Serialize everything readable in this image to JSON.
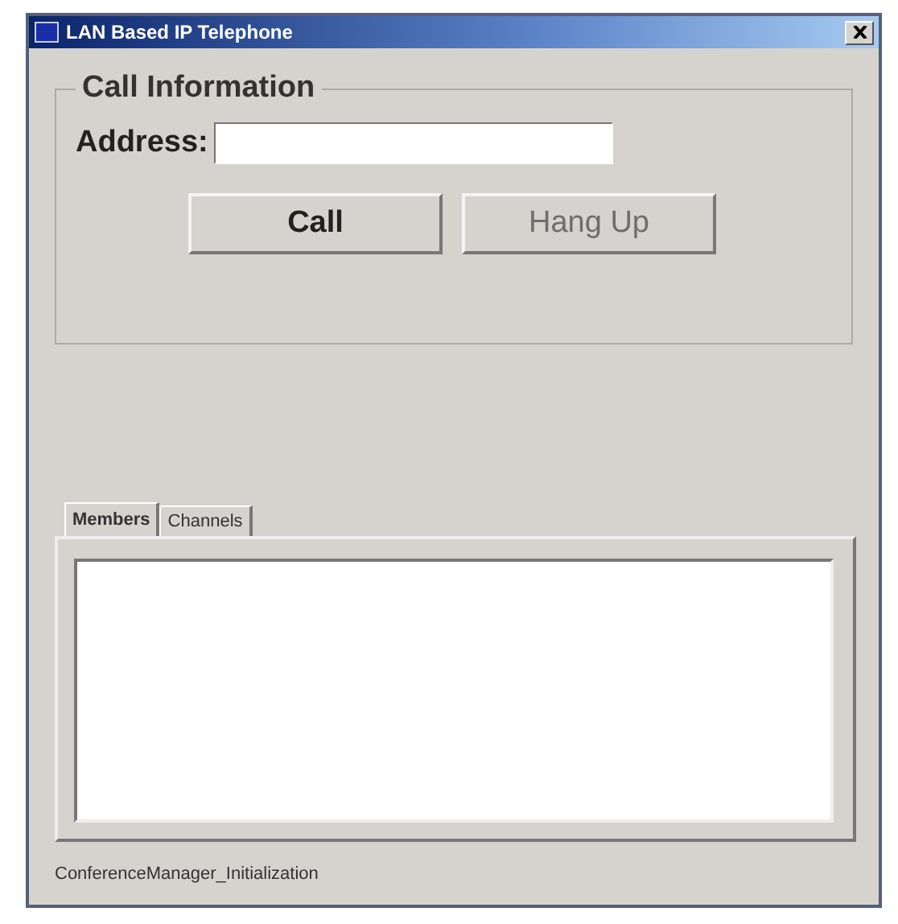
{
  "window": {
    "title": "LAN Based IP Telephone"
  },
  "call_information": {
    "title": "Call Information",
    "address_label": "Address:",
    "buttons": [
      {
        "label": "Call",
        "disabled": false
      },
      {
        "label": "Hang Up",
        "disabled": true
      }
    ]
  },
  "tabs": [
    {
      "label": "Members",
      "selected": true
    },
    {
      "label": "Channels",
      "selected": false
    }
  ],
  "status_bar": "ConferenceManager_Initialization"
}
